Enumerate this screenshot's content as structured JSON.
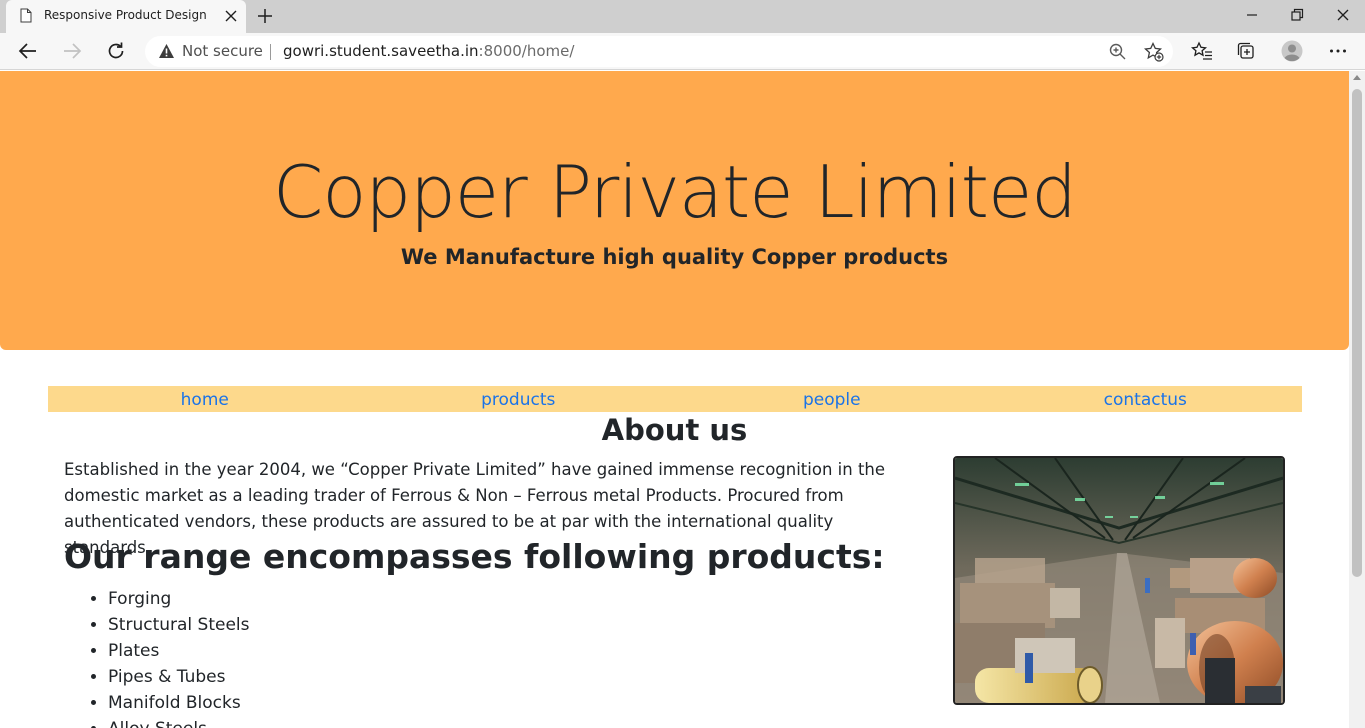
{
  "browser": {
    "tab_title": "Responsive Product Design",
    "security_label": "Not secure",
    "url_host": "gowri.student.saveetha.in",
    "url_rest": ":8000/home/"
  },
  "hero": {
    "title": "Copper Private Limited",
    "subtitle": "We Manufacture high quality Copper products"
  },
  "nav": {
    "items": [
      {
        "label": "home"
      },
      {
        "label": "products"
      },
      {
        "label": "people"
      },
      {
        "label": "contactus"
      }
    ]
  },
  "about": {
    "heading": "About us",
    "paragraph": "Established in the year 2004, we “Copper Private Limited” have gained immense recognition in the domestic market as a leading trader of Ferrous & Non – Ferrous metal Products. Procured from authenticated vendors, these products are assured to be at par with the international quality standards.",
    "range_heading": "Our range encompasses following products:",
    "products": [
      "Forging",
      "Structural Steels",
      "Plates",
      "Pipes & Tubes",
      "Manifold Blocks",
      "Alloy Steels"
    ]
  },
  "colors": {
    "hero_bg": "#ffa94d",
    "nav_bg": "#fdd98c",
    "link": "#1a73e8"
  },
  "icons": {
    "tab": "page-icon",
    "security": "warning-triangle-icon",
    "image": "factory-photo"
  }
}
